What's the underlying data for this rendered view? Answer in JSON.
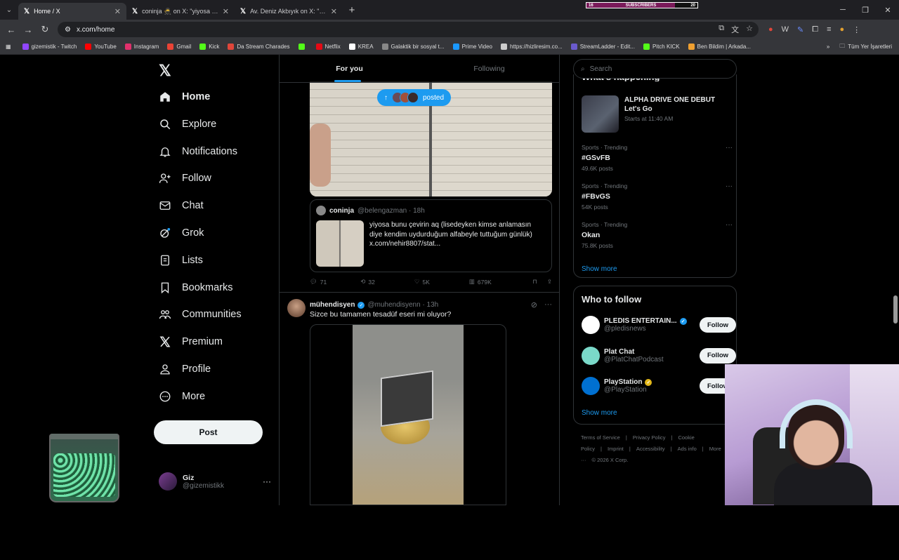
{
  "browser": {
    "tabs": [
      {
        "title": "Home / X",
        "active": true
      },
      {
        "title": "coninja 🥷 on X: \"yiyosa bunu ç",
        "active": false
      },
      {
        "title": "Av. Deniz Akbıyık on X: \"Bana b",
        "active": false
      }
    ],
    "url": "x.com/home",
    "subscribers": {
      "label": "SUBSCRIBERS",
      "current": "16",
      "goal": "20",
      "progress": 0.8
    },
    "bookmarks": [
      {
        "label": "gizemistik - Twitch",
        "color": "#9146ff"
      },
      {
        "label": "YouTube",
        "color": "#ff0000"
      },
      {
        "label": "Instagram",
        "color": "#e1306c"
      },
      {
        "label": "Gmail",
        "color": "#ea4335"
      },
      {
        "label": "Kick",
        "color": "#53fc18"
      },
      {
        "label": "Da Stream Charades",
        "color": "#e0463a"
      },
      {
        "label": "",
        "color": "#53fc18"
      },
      {
        "label": "Netflix",
        "color": "#e50914"
      },
      {
        "label": "KREA",
        "color": "#ffffff"
      },
      {
        "label": "Galaktik bir sosyal t...",
        "color": "#888888"
      },
      {
        "label": "Prime Video",
        "color": "#1a98ff"
      },
      {
        "label": "https://hizliresim.co...",
        "color": "#cccccc"
      },
      {
        "label": "StreamLadder - Edit...",
        "color": "#6a5acd"
      },
      {
        "label": "Pitch KICK",
        "color": "#53fc18"
      },
      {
        "label": "Ben Bildim | Arkada...",
        "color": "#f0a030"
      }
    ],
    "all_bookmarks": "Tüm Yer İşaretleri"
  },
  "nav": {
    "items": [
      {
        "label": "Home",
        "icon": "home-icon",
        "active": true
      },
      {
        "label": "Explore",
        "icon": "search-icon"
      },
      {
        "label": "Notifications",
        "icon": "bell-icon"
      },
      {
        "label": "Follow",
        "icon": "follow-icon"
      },
      {
        "label": "Chat",
        "icon": "mail-icon"
      },
      {
        "label": "Grok",
        "icon": "grok-icon"
      },
      {
        "label": "Lists",
        "icon": "list-icon"
      },
      {
        "label": "Bookmarks",
        "icon": "bookmark-icon"
      },
      {
        "label": "Communities",
        "icon": "communities-icon"
      },
      {
        "label": "Premium",
        "icon": "x-icon"
      },
      {
        "label": "Profile",
        "icon": "profile-icon"
      },
      {
        "label": "More",
        "icon": "more-icon"
      }
    ],
    "post_label": "Post",
    "account": {
      "name": "Giz",
      "handle": "@gizemistikk"
    }
  },
  "timeline": {
    "tabs": [
      "For you",
      "Following"
    ],
    "posted_pill": "posted",
    "quote": {
      "name": "coninja",
      "handle": "@belengazman · 18h",
      "text": "yiyosa bunu çevirin aq (lisedeyken kimse anlamasın diye kendim uydurduğum alfabeyle tuttuğum günlük) x.com/nehir8807/stat..."
    },
    "actions": {
      "replies": "71",
      "reposts": "32",
      "likes": "5K",
      "views": "679K"
    },
    "post2": {
      "name": "mühendisyen",
      "handle": "@muhendisyenn · 13h",
      "text": "Sizce bu tamamen tesadüf eseri mi oluyor?"
    }
  },
  "rightcol": {
    "search_placeholder": "Search",
    "whats_happening": "What's happening",
    "event": {
      "title": "ALPHA DRIVE ONE DEBUT Let's Go",
      "time": "Starts at 11:40 AM"
    },
    "trends": [
      {
        "category": "Sports · Trending",
        "name": "#GSvFB",
        "count": "49.6K posts"
      },
      {
        "category": "Sports · Trending",
        "name": "#FBvGS",
        "count": "54K posts"
      },
      {
        "category": "Sports · Trending",
        "name": "Okan",
        "count": "75.8K posts"
      }
    ],
    "show_more": "Show more",
    "who_to_follow": "Who to follow",
    "accounts": [
      {
        "name": "PLEDIS ENTERTAIN...",
        "handle": "@pledisnews",
        "badge": "blue",
        "color": "#ffffff"
      },
      {
        "name": "Plat Chat",
        "handle": "@PlatChatPodcast",
        "badge": "",
        "color": "#7ad9c9"
      },
      {
        "name": "PlayStation",
        "handle": "@PlayStation",
        "badge": "gold",
        "color": "#0070d1"
      }
    ],
    "follow_label": "Follow",
    "footer": [
      "Terms of Service",
      "|",
      "Privacy Policy",
      "|",
      "Cookie Policy",
      "|",
      "Imprint",
      "|",
      "Accessibility",
      "|",
      "Ads info",
      "|",
      "More ···",
      "© 2026 X Corp."
    ]
  }
}
